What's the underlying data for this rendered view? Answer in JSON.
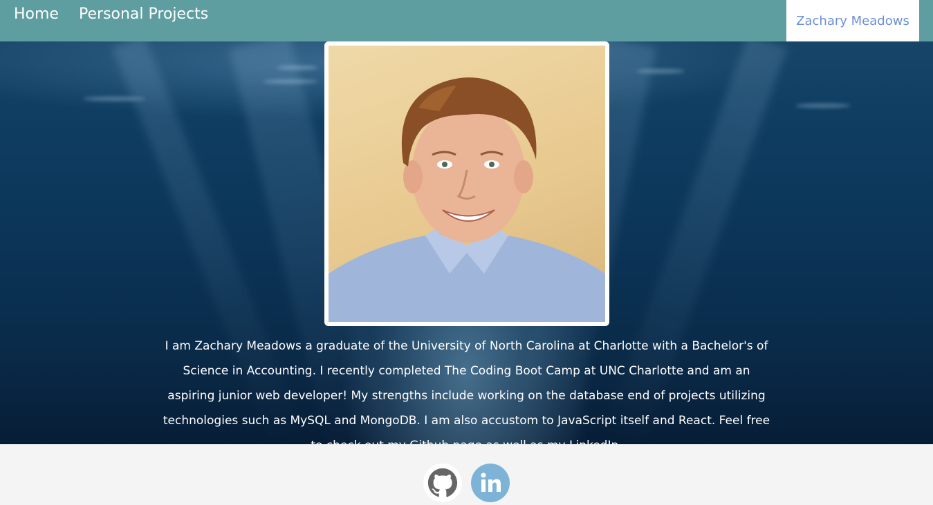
{
  "nav": {
    "home_label": "Home",
    "projects_label": "Personal Projects",
    "brand_label": "Zachary Meadows"
  },
  "profile": {
    "bio": "I am Zachary Meadows a graduate of the University of North Carolina at Charlotte with a Bachelor's of Science in Accounting. I recently completed The Coding Boot Camp at UNC Charlotte and am an aspiring junior web developer! My strengths include working on the database end of projects utilizing technologies such as MySQL and MongoDB. I am also accustom to JavaScript itself and React. Feel free to check out my Github page as well as my LinkedIn."
  },
  "social": {
    "github_icon": "github-icon",
    "linkedin_icon": "linkedin-icon",
    "linkedin_text": "in"
  },
  "colors": {
    "navbar": "#5f9ea0",
    "brand_text": "#6b8fd6",
    "linkedin": "#7db3d6",
    "github": "#666666"
  }
}
